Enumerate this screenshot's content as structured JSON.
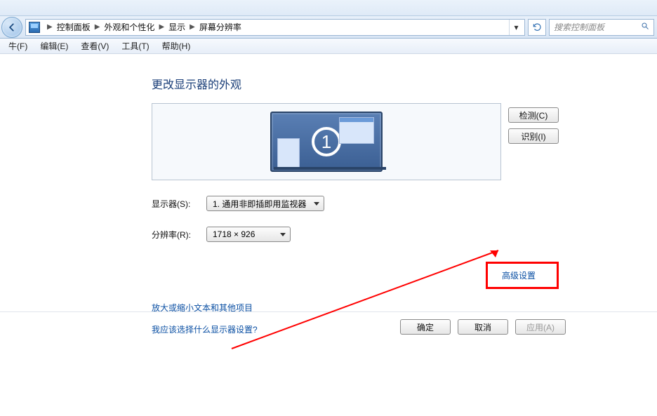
{
  "breadcrumb": {
    "items": [
      "控制面板",
      "外观和个性化",
      "显示",
      "屏幕分辨率"
    ]
  },
  "search": {
    "placeholder": "搜索控制面板"
  },
  "menu": {
    "file": "牛(F)",
    "edit": "编辑(E)",
    "view": "查看(V)",
    "tools": "工具(T)",
    "help": "帮助(H)"
  },
  "page": {
    "title": "更改显示器的外观",
    "monitor_number": "1",
    "detect_btn": "检测(C)",
    "identify_btn": "识别(I)",
    "display_label": "显示器(S):",
    "display_value": "1. 通用非即插即用监视器",
    "resolution_label": "分辨率(R):",
    "resolution_value": "1718 × 926",
    "advanced_link": "高级设置",
    "link_zoom": "放大或缩小文本和其他项目",
    "link_which": "我应该选择什么显示器设置?",
    "ok": "确定",
    "cancel": "取消",
    "apply": "应用(A)"
  }
}
